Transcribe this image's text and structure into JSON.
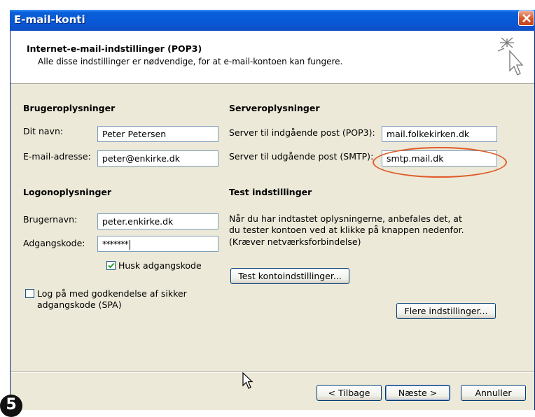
{
  "window": {
    "title": "E-mail-konti"
  },
  "header": {
    "title": "Internet-e-mail-indstillinger (POP3)",
    "subtitle": "Alle disse indstillinger er nødvendige, for at e-mail-kontoen kan fungere."
  },
  "user_info": {
    "heading": "Brugeroplysninger",
    "name_label": "Dit navn:",
    "name_value": "Peter Petersen",
    "email_label": "E-mail-adresse:",
    "email_value": "peter@enkirke.dk"
  },
  "server_info": {
    "heading": "Serveroplysninger",
    "incoming_label": "Server til indgående post (POP3):",
    "incoming_value": "mail.folkekirken.dk",
    "outgoing_label": "Server til udgående post (SMTP):",
    "outgoing_value": "smtp.mail.dk"
  },
  "logon_info": {
    "heading": "Logonoplysninger",
    "username_label": "Brugernavn:",
    "username_value": "peter.enkirke.dk",
    "password_label": "Adgangskode:",
    "password_value": "*******",
    "remember_label": "Husk adgangskode",
    "remember_checked": true,
    "spa_label_line1": "Log på med godkendelse af sikker",
    "spa_label_line2": "adgangskode (SPA)",
    "spa_checked": false
  },
  "test_settings": {
    "heading": "Test indstillinger",
    "desc_line1": "Når du har indtastet oplysningerne, anbefales det, at",
    "desc_line2": "du tester kontoen ved at klikke på knappen nedenfor.",
    "desc_line3": "(Kræver netværksforbindelse)",
    "test_button": "Test kontoindstillinger..."
  },
  "more_settings_button": "Flere indstillinger...",
  "footer": {
    "back_button": "< Tilbage",
    "next_button": "Næste >",
    "cancel_button": "Annuller"
  },
  "step_number": "5",
  "colors": {
    "titlebar": "#0858d6",
    "dialog_bg": "#ece9d8",
    "highlight_oval": "#e05a2a"
  }
}
